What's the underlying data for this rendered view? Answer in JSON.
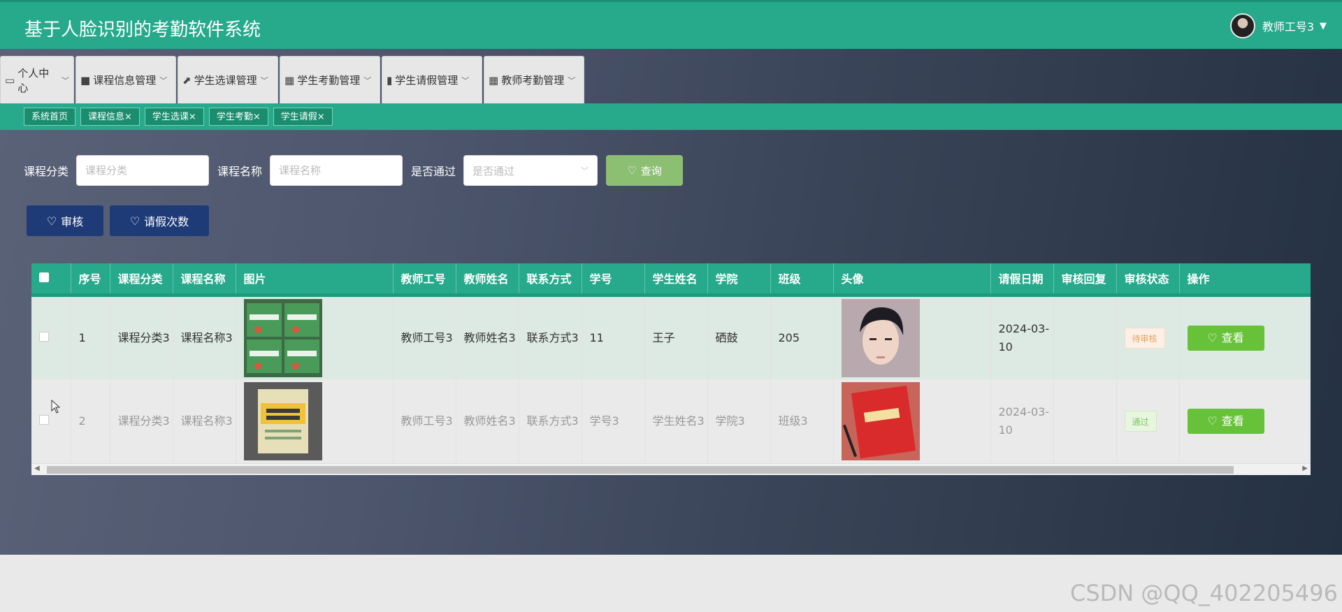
{
  "header": {
    "title": "基于人脸识别的考勤软件系统",
    "user_name": "教师工号3",
    "caret": "▼"
  },
  "menu": [
    {
      "label": "个人中心",
      "icon": "card-icon"
    },
    {
      "label": "课程信息管理",
      "icon": "book-icon"
    },
    {
      "label": "学生选课管理",
      "icon": "chart-icon"
    },
    {
      "label": "学生考勤管理",
      "icon": "grid-icon"
    },
    {
      "label": "学生请假管理",
      "icon": "bars-icon"
    },
    {
      "label": "教师考勤管理",
      "icon": "grid-icon"
    }
  ],
  "tabs": [
    "系统首页",
    "课程信息×",
    "学生选课×",
    "学生考勤×",
    "学生请假×"
  ],
  "search": {
    "category_label": "课程分类",
    "category_placeholder": "课程分类",
    "name_label": "课程名称",
    "name_placeholder": "课程名称",
    "pass_label": "是否通过",
    "pass_placeholder": "是否通过",
    "query_label": "查询"
  },
  "actions": {
    "review_label": "审核",
    "count_label": "请假次数"
  },
  "table": {
    "columns": [
      "序号",
      "课程分类",
      "课程名称",
      "图片",
      "教师工号",
      "教师姓名",
      "联系方式",
      "学号",
      "学生姓名",
      "学院",
      "班级",
      "头像",
      "请假日期",
      "审核回复",
      "审核状态",
      "操作"
    ],
    "rows": [
      {
        "index": "1",
        "category": "课程分类3",
        "course": "课程名称3",
        "teacher_id": "教师工号3",
        "teacher_name": "教师姓名3",
        "contact": "联系方式3",
        "student_id": "11",
        "student_name": "王子",
        "college": "硒鼓",
        "class": "205",
        "date": "2024-03-10",
        "reply": "",
        "status": "待审核",
        "action": "查看"
      },
      {
        "index": "2",
        "category": "课程分类3",
        "course": "课程名称3",
        "teacher_id": "教师工号3",
        "teacher_name": "教师姓名3",
        "contact": "联系方式3",
        "student_id": "学号3",
        "student_name": "学生姓名3",
        "college": "学院3",
        "class": "班级3",
        "date": "2024-03-10",
        "reply": "",
        "status": "通过",
        "action": "查看"
      }
    ]
  },
  "colors": {
    "primary": "#27a98b",
    "dark_button": "#1e3b78",
    "view_button": "#67c23a",
    "query_button": "#8dbf73"
  },
  "watermark": "CSDN @QQ_402205496"
}
